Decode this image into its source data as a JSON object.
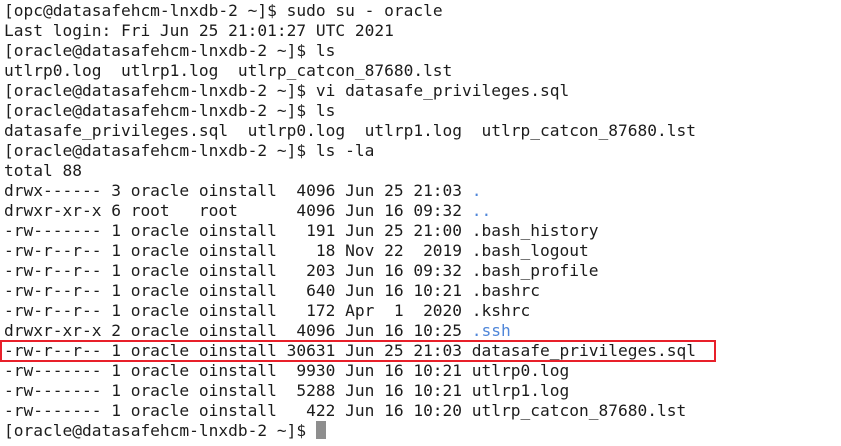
{
  "terminal": {
    "lines": [
      {
        "kind": "prompt",
        "prompt": "[opc@datasafehcm-lnxdb-2 ~]$ ",
        "command": "sudo su - oracle"
      },
      {
        "kind": "output",
        "text": "Last login: Fri Jun 25 21:01:27 UTC 2021"
      },
      {
        "kind": "prompt",
        "prompt": "[oracle@datasafehcm-lnxdb-2 ~]$ ",
        "command": "ls"
      },
      {
        "kind": "output",
        "text": "utlrp0.log  utlrp1.log  utlrp_catcon_87680.lst"
      },
      {
        "kind": "prompt",
        "prompt": "[oracle@datasafehcm-lnxdb-2 ~]$ ",
        "command": "vi datasafe_privileges.sql"
      },
      {
        "kind": "prompt",
        "prompt": "[oracle@datasafehcm-lnxdb-2 ~]$ ",
        "command": "ls"
      },
      {
        "kind": "output",
        "text": "datasafe_privileges.sql  utlrp0.log  utlrp1.log  utlrp_catcon_87680.lst"
      },
      {
        "kind": "prompt",
        "prompt": "[oracle@datasafehcm-lnxdb-2 ~]$ ",
        "command": "ls -la"
      },
      {
        "kind": "output",
        "text": "total 88"
      },
      {
        "kind": "listing",
        "meta": "drwx------ 3 oracle oinstall  4096 Jun 25 21:03 ",
        "name": ".",
        "is_dir": true
      },
      {
        "kind": "listing",
        "meta": "drwxr-xr-x 6 root   root      4096 Jun 16 09:32 ",
        "name": "..",
        "is_dir": true
      },
      {
        "kind": "listing",
        "meta": "-rw------- 1 oracle oinstall   191 Jun 25 21:00 ",
        "name": ".bash_history",
        "is_dir": false
      },
      {
        "kind": "listing",
        "meta": "-rw-r--r-- 1 oracle oinstall    18 Nov 22  2019 ",
        "name": ".bash_logout",
        "is_dir": false
      },
      {
        "kind": "listing",
        "meta": "-rw-r--r-- 1 oracle oinstall   203 Jun 16 09:32 ",
        "name": ".bash_profile",
        "is_dir": false
      },
      {
        "kind": "listing",
        "meta": "-rw-r--r-- 1 oracle oinstall   640 Jun 16 10:21 ",
        "name": ".bashrc",
        "is_dir": false
      },
      {
        "kind": "listing",
        "meta": "-rw-r--r-- 1 oracle oinstall   172 Apr  1  2020 ",
        "name": ".kshrc",
        "is_dir": false
      },
      {
        "kind": "listing",
        "meta": "drwxr-xr-x 2 oracle oinstall  4096 Jun 16 10:25 ",
        "name": ".ssh",
        "is_dir": true
      },
      {
        "kind": "listing",
        "meta": "-rw-r--r-- 1 oracle oinstall 30631 Jun 25 21:03 ",
        "name": "datasafe_privileges.sql",
        "is_dir": false,
        "highlighted": true
      },
      {
        "kind": "listing",
        "meta": "-rw------- 1 oracle oinstall  9930 Jun 16 10:21 ",
        "name": "utlrp0.log",
        "is_dir": false
      },
      {
        "kind": "listing",
        "meta": "-rw------- 1 oracle oinstall  5288 Jun 16 10:21 ",
        "name": "utlrp1.log",
        "is_dir": false
      },
      {
        "kind": "listing",
        "meta": "-rw------- 1 oracle oinstall   422 Jun 16 10:20 ",
        "name": "utlrp_catcon_87680.lst",
        "is_dir": false
      },
      {
        "kind": "prompt",
        "prompt": "[oracle@datasafehcm-lnxdb-2 ~]$ ",
        "command": "",
        "cursor": true
      }
    ]
  },
  "colors": {
    "background": "#ffffff",
    "text": "#1c1c1c",
    "directory": "#4f86d9",
    "highlight_border": "#e8202a",
    "cursor": "#8e8e8e"
  }
}
